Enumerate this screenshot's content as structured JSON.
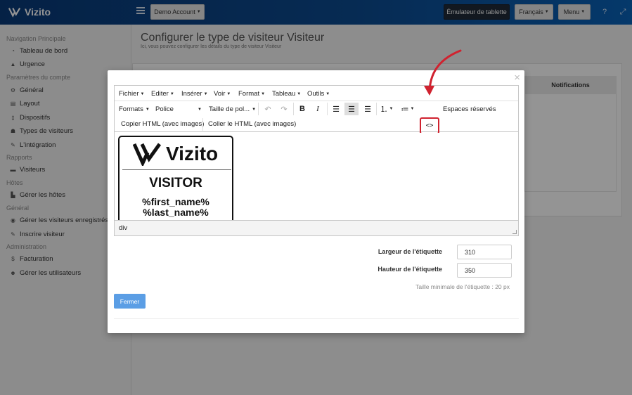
{
  "app": {
    "brand": "Vizito",
    "brand_color": "#0b4a8f"
  },
  "topbar": {
    "account": "Demo Account",
    "kiosk": "Émulateur de tablette",
    "language": "Français",
    "menu": "Menu"
  },
  "sidebar": {
    "sections": [
      {
        "title": "Navigation Principale",
        "items": [
          {
            "label": "Tableau de bord",
            "icon": "dashboard-icon"
          },
          {
            "label": "Urgence",
            "icon": "warning-icon"
          }
        ]
      },
      {
        "title": "Paramètres du compte",
        "items": [
          {
            "label": "Général",
            "icon": "gear-icon"
          },
          {
            "label": "Layout",
            "icon": "layout-icon"
          },
          {
            "label": "Dispositifs",
            "icon": "tablet-icon"
          },
          {
            "label": "Types de visiteurs",
            "icon": "users-icon"
          },
          {
            "label": "L'intégration",
            "icon": "plug-icon"
          }
        ]
      },
      {
        "title": "Rapports",
        "items": [
          {
            "label": "Visiteurs",
            "icon": "book-icon"
          }
        ]
      },
      {
        "title": "Hôtes",
        "items": [
          {
            "label": "Gérer les hôtes",
            "icon": "host-icon"
          }
        ]
      },
      {
        "title": "Général",
        "items": [
          {
            "label": "Gérer les visiteurs enregistrés",
            "icon": "user-circle-icon"
          },
          {
            "label": "Inscrire visiteur",
            "icon": "pencil-icon"
          }
        ]
      },
      {
        "title": "Administration",
        "items": [
          {
            "label": "Facturation",
            "icon": "dollar-icon"
          },
          {
            "label": "Gérer les utilisateurs",
            "icon": "user-cog-icon"
          }
        ]
      }
    ]
  },
  "page": {
    "title": "Configurer le type de visiteur Visiteur",
    "subtitle": "Ici, vous pouvez configurer les détails du type de visiteur Visiteur",
    "notifications": "Notifications"
  },
  "editor": {
    "menus": [
      "Fichier",
      "Editer",
      "Insérer",
      "Voir",
      "Format",
      "Tableau",
      "Outils"
    ],
    "formats": "Formats",
    "font": "Police",
    "font_size": "Taille de pol...",
    "placeholders": "Espaces réservés",
    "copy_html": "Copier HTML (avec images)",
    "paste_html": "Coller le HTML (avec images)",
    "code_symbol": "<>",
    "status_path": "div",
    "highlight_color": "#d0222f"
  },
  "badge": {
    "logo_text": "Vizito",
    "title": "VISITOR",
    "first_name": "%first_name%",
    "last_name": "%last_name%"
  },
  "form": {
    "width_label": "Largeur de l'étiquette",
    "width_value": "310",
    "height_label": "Hauteur de l'étiquette",
    "height_value": "350",
    "hint": "Taille minimale de l'étiquette : 20 px",
    "close_button": "Fermer"
  }
}
